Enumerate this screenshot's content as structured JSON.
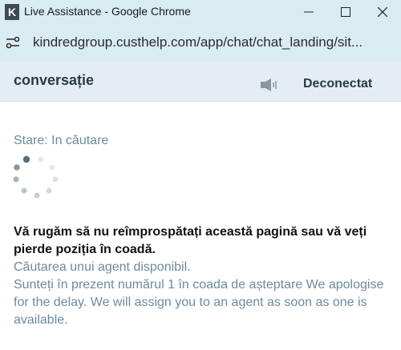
{
  "window": {
    "title": "Live Assistance - Google Chrome",
    "app_icon_glyph": "K",
    "controls": [
      "minimize-icon",
      "maximize-icon",
      "close-icon"
    ]
  },
  "address_bar": {
    "url": "kindredgroup.custhelp.com/app/chat/chat_landing/sit..."
  },
  "chat_header": {
    "title": "conversație",
    "disconnect_label": "Deconectat"
  },
  "status": {
    "text": "Stare: In căutare"
  },
  "messages": {
    "warning": "Vă rugăm să nu reîmprospătați această pagină sau vă veți pierde poziția în coadă.",
    "searching": "Căutarea unui agent disponibil.",
    "queue": "Sunteți în prezent numărul 1 în coada de așteptare  We apologise for the delay. We will assign you to an agent as soon as one is available."
  },
  "colors": {
    "chrome_bg": "#d9ecf2",
    "header_bg": "#e4edf3",
    "accent_text": "#6b8ba0",
    "spinner_dark": "#5a6e7c"
  }
}
